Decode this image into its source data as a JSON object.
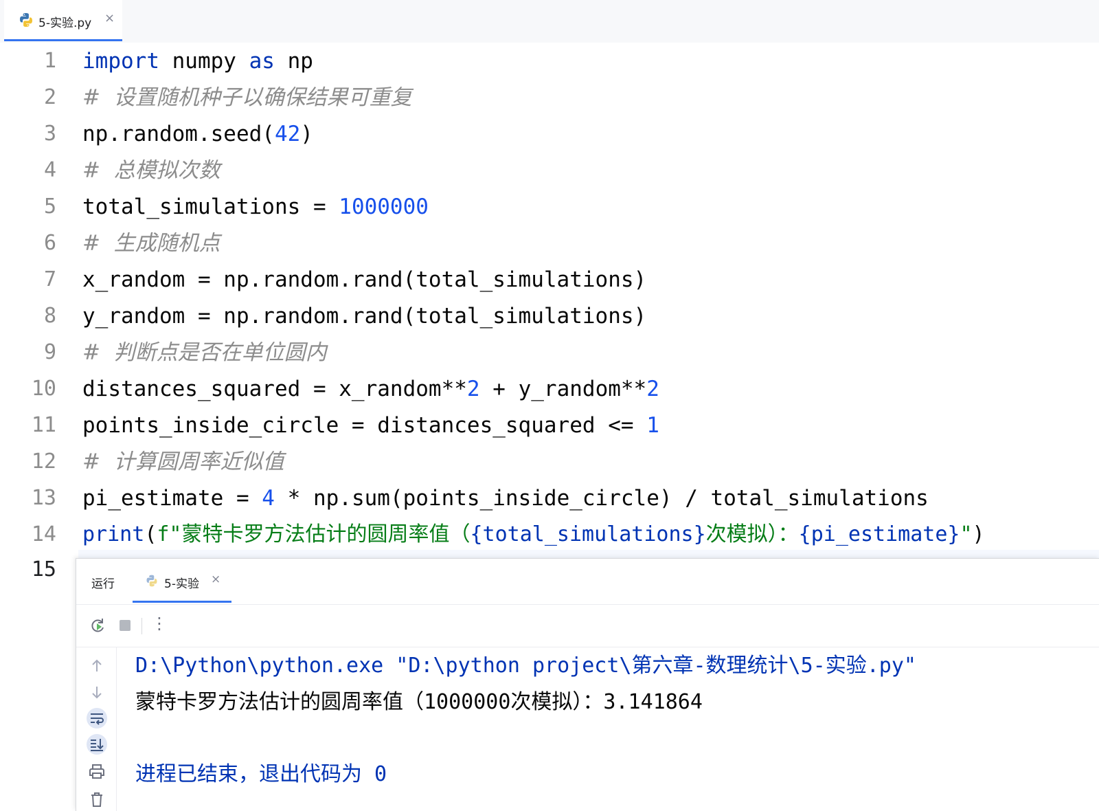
{
  "editor_tab": {
    "filename": "5-实验.py",
    "close_glyph": "×"
  },
  "gutter": {
    "line_numbers": [
      "1",
      "2",
      "3",
      "4",
      "5",
      "6",
      "7",
      "8",
      "9",
      "10",
      "11",
      "12",
      "13",
      "14",
      "15"
    ]
  },
  "code": {
    "l1": {
      "kw1": "import",
      "t1": " numpy ",
      "kw2": "as",
      "t2": " np"
    },
    "l2": {
      "comment": "#  设置随机种子以确保结果可重复"
    },
    "l3": {
      "t1": "np.random.seed(",
      "num": "42",
      "t2": ")"
    },
    "l4": {
      "comment": "#  总模拟次数"
    },
    "l5": {
      "t1": "total_simulations = ",
      "num": "1000000"
    },
    "l6": {
      "comment": "#  生成随机点"
    },
    "l7": {
      "t1": "x_random = np.random.rand(total_simulations)"
    },
    "l8": {
      "t1": "y_random = np.random.rand(total_simulations)"
    },
    "l9": {
      "comment": "#  判断点是否在单位圆内"
    },
    "l10": {
      "t1": "distances_squared = x_random**",
      "n1": "2",
      "t2": " + y_random**",
      "n2": "2"
    },
    "l11": {
      "t1": "points_inside_circle = distances_squared <= ",
      "num": "1"
    },
    "l12": {
      "comment": "#  计算圆周率近似值"
    },
    "l13": {
      "t1": "pi_estimate = ",
      "num": "4",
      "t2": " * np.sum(points_inside_circle) / total_simulations"
    },
    "l14": {
      "fn": "print",
      "p1": "(",
      "s1": "f\"蒙特卡罗方法估计的圆周率值（",
      "b1": "{total_simulations}",
      "s2": "次模拟）：",
      "b2": "{pi_estimate}",
      "s3": "\"",
      "p2": ")"
    }
  },
  "run_panel": {
    "title": "运行",
    "tab_label": "5-实验",
    "close_glyph": "×",
    "more_glyph": "⋮",
    "console": {
      "command": "D:\\Python\\python.exe \"D:\\python project\\第六章-数理统计\\5-实验.py\"",
      "output": "蒙特卡罗方法估计的圆周率值（1000000次模拟）：3.141864",
      "exit_message": "进程已结束，退出代码为 0"
    }
  },
  "colors": {
    "keyword": "#0033b3",
    "number": "#1750eb",
    "comment": "#8c8c8c",
    "string": "#067d17",
    "accent": "#3574f0"
  }
}
